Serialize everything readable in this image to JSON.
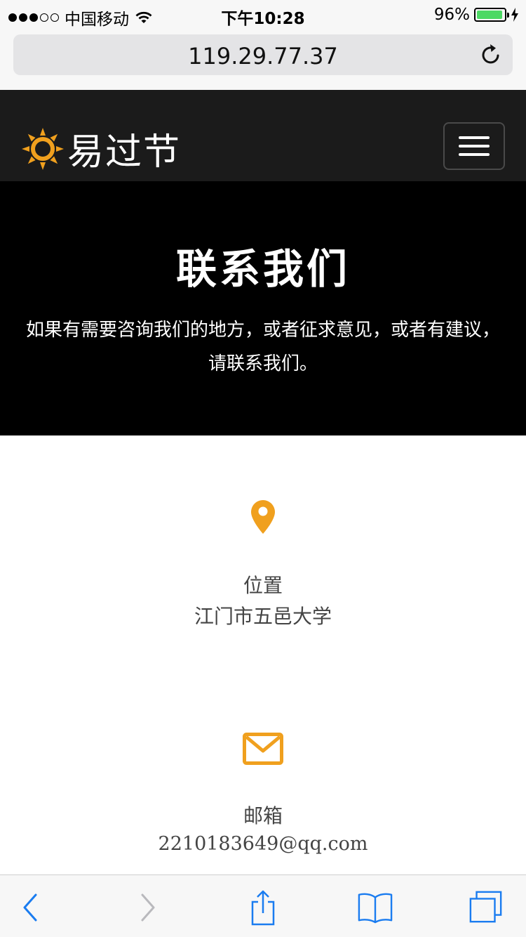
{
  "status_bar": {
    "carrier": "中国移动",
    "time": "下午10:28",
    "battery": "96%",
    "battery_level": 0.96,
    "signal_bars_filled": 3,
    "signal_bars_total": 5
  },
  "browser": {
    "url": "119.29.77.37"
  },
  "navbar": {
    "brand": "易过节",
    "brand_color": "#f0a01e"
  },
  "hero": {
    "title": "联系我们",
    "description_line1": "如果有需要咨询我们的地方，或者征求意见，或者有建议，",
    "description_line2": "请联系我们。"
  },
  "contact": {
    "accent_color": "#f0a01e",
    "location": {
      "icon": "map-marker-icon",
      "label": "位置",
      "value": "江门市五邑大学"
    },
    "email": {
      "icon": "envelope-icon",
      "label": "邮箱",
      "value": "2210183649@qq.com"
    }
  },
  "toolbar": {
    "icons": [
      "back-icon",
      "forward-icon",
      "share-icon",
      "bookmarks-icon",
      "tabs-icon"
    ]
  }
}
